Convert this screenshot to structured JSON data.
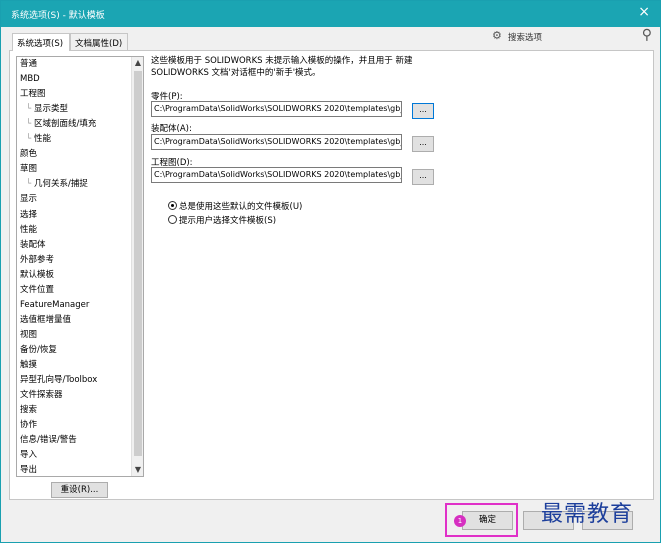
{
  "window": {
    "title": "系统选项(S) - 默认模板",
    "close_glyph": "×"
  },
  "tabs": [
    {
      "label": "系统选项(S)",
      "active": true
    },
    {
      "label": "文档属性(D)",
      "active": false
    }
  ],
  "search": {
    "label": "搜索选项",
    "gear_icon": "gear-icon",
    "search_icon": "search-icon"
  },
  "tree": {
    "items": [
      {
        "label": "普通",
        "child": false
      },
      {
        "label": "MBD",
        "child": false
      },
      {
        "label": "工程图",
        "child": false
      },
      {
        "label": "显示类型",
        "child": true
      },
      {
        "label": "区域剖面线/填充",
        "child": true
      },
      {
        "label": "性能",
        "child": true
      },
      {
        "label": "颜色",
        "child": false
      },
      {
        "label": "草图",
        "child": false
      },
      {
        "label": "几何关系/捕捉",
        "child": true
      },
      {
        "label": "显示",
        "child": false
      },
      {
        "label": "选择",
        "child": false
      },
      {
        "label": "性能",
        "child": false
      },
      {
        "label": "装配体",
        "child": false
      },
      {
        "label": "外部参考",
        "child": false
      },
      {
        "label": "默认模板",
        "child": false
      },
      {
        "label": "文件位置",
        "child": false
      },
      {
        "label": "FeatureManager",
        "child": false
      },
      {
        "label": "选值框增量值",
        "child": false
      },
      {
        "label": "视图",
        "child": false
      },
      {
        "label": "备份/恢复",
        "child": false
      },
      {
        "label": "触摸",
        "child": false
      },
      {
        "label": "异型孔向导/Toolbox",
        "child": false
      },
      {
        "label": "文件探索器",
        "child": false
      },
      {
        "label": "搜索",
        "child": false
      },
      {
        "label": "协作",
        "child": false
      },
      {
        "label": "信息/错误/警告",
        "child": false
      },
      {
        "label": "导入",
        "child": false
      },
      {
        "label": "导出",
        "child": false
      }
    ],
    "scroll_up_glyph": "▲",
    "scroll_down_glyph": "▼"
  },
  "reset_button": "重设(R)...",
  "description": "这些模板用于 SOLIDWORKS 未提示输入模板的操作，并且用于 新建 SOLIDWORKS 文档'对话框中的'新手'模式。",
  "fields": {
    "part": {
      "label": "零件(P):",
      "value": "C:\\ProgramData\\SolidWorks\\SOLIDWORKS 2020\\templates\\gb_p",
      "browse": "..."
    },
    "assembly": {
      "label": "装配体(A):",
      "value": "C:\\ProgramData\\SolidWorks\\SOLIDWORKS 2020\\templates\\gb_a",
      "browse": "..."
    },
    "drawing": {
      "label": "工程图(D):",
      "value": "C:\\ProgramData\\SolidWorks\\SOLIDWORKS 2020\\templates\\gb_a",
      "browse": "..."
    }
  },
  "radios": [
    {
      "label": "总是使用这些默认的文件模板(U)",
      "checked": true
    },
    {
      "label": "提示用户选择文件模板(S)",
      "checked": false
    }
  ],
  "buttons": {
    "ok": "确定",
    "step_number": "1"
  },
  "watermark": "最需教育",
  "colors": {
    "titlebar": "#1ba5b3",
    "highlight": "#e030c8",
    "watermark": "#1d3f9c"
  }
}
